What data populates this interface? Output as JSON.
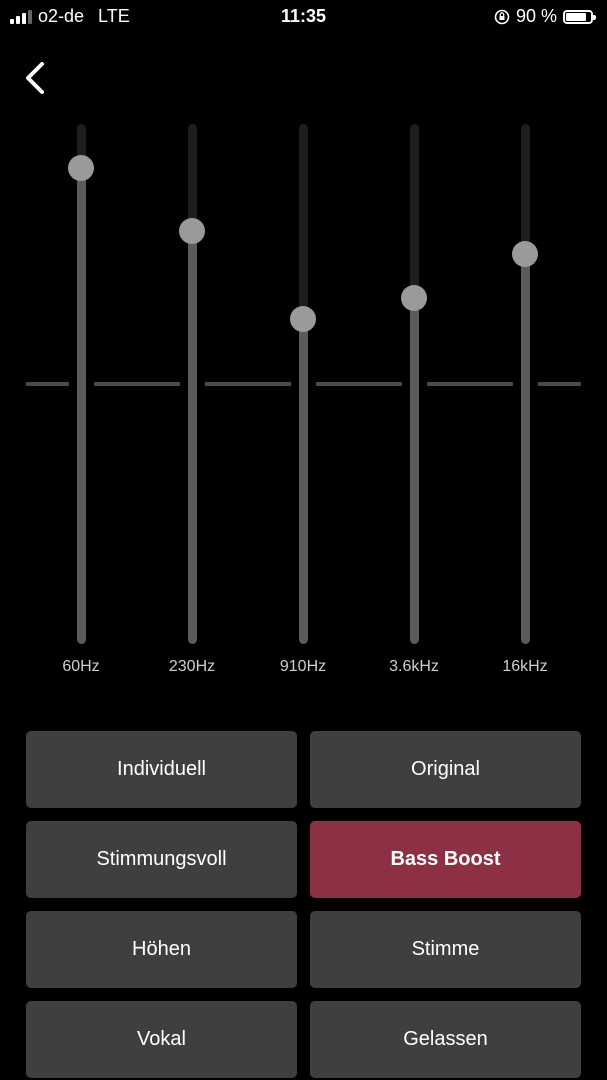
{
  "status_bar": {
    "carrier": "o2-de",
    "network": "LTE",
    "time": "11:35",
    "battery": "90 %",
    "battery_level": 0.9
  },
  "equalizer": {
    "bands": [
      {
        "label": "60Hz",
        "level": 0.83
      },
      {
        "label": "230Hz",
        "level": 0.59
      },
      {
        "label": "910Hz",
        "level": 0.25
      },
      {
        "label": "3.6kHz",
        "level": 0.33
      },
      {
        "label": "16kHz",
        "level": 0.5
      }
    ]
  },
  "presets": [
    {
      "label": "Individuell",
      "selected": false
    },
    {
      "label": "Original",
      "selected": false
    },
    {
      "label": "Stimmungsvoll",
      "selected": false
    },
    {
      "label": "Bass Boost",
      "selected": true
    },
    {
      "label": "Höhen",
      "selected": false
    },
    {
      "label": "Stimme",
      "selected": false
    },
    {
      "label": "Vokal",
      "selected": false
    },
    {
      "label": "Gelassen",
      "selected": false
    }
  ],
  "colors": {
    "selected_preset": "#8e3044",
    "preset_background": "#3f3f3f",
    "knob": "#9a9a9a"
  }
}
